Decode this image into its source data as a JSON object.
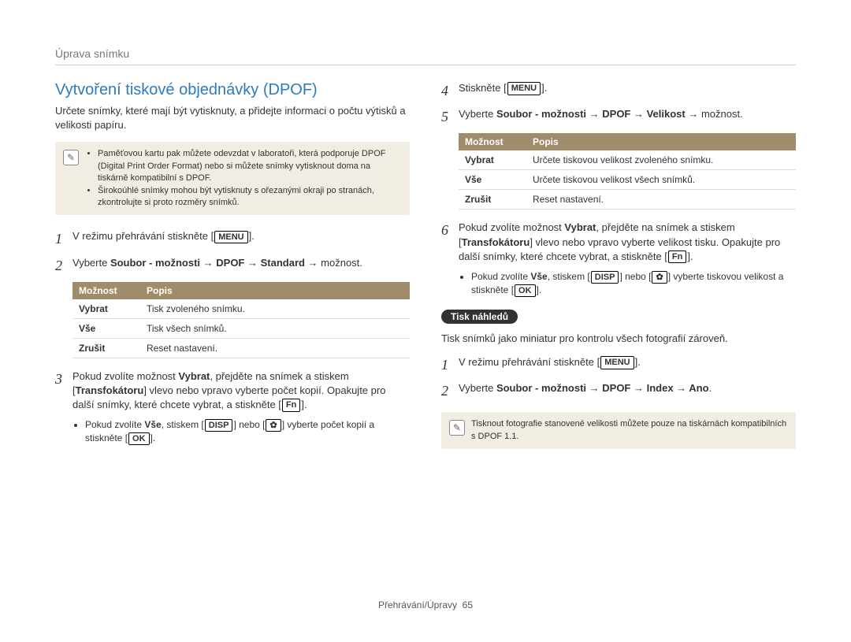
{
  "header": "Úprava snímku",
  "left": {
    "title": "Vytvoření tiskové objednávky (DPOF)",
    "intro": "Určete snímky, které mají být vytisknuty, a přidejte informaci o počtu výtisků a velikosti papíru.",
    "note_icon": "✎",
    "notes": [
      "Paměťovou kartu pak můžete odevzdat v laboratoři, která podporuje DPOF (Digital Print Order Format) nebo si můžete snímky vytisknout doma na tiskárně kompatibilní s DPOF.",
      "Širokoúhlé snímky mohou být vytisknuty s ořezanými okraji po stranách, zkontrolujte si proto rozměry snímků."
    ],
    "step1_num": "1",
    "step1_a": "V režimu přehrávání stiskněte [",
    "step1_btn": "MENU",
    "step1_b": "].",
    "step2_num": "2",
    "step2_a": "Vyberte ",
    "step2_bold": "Soubor - možnosti → DPOF → Standard",
    "step2_b": " → možnost.",
    "table_h1": "Možnost",
    "table_h2": "Popis",
    "table_rows": [
      {
        "k": "Vybrat",
        "v": "Tisk zvoleného snímku."
      },
      {
        "k": "Vše",
        "v": "Tisk všech snímků."
      },
      {
        "k": "Zrušit",
        "v": "Reset nastavení."
      }
    ],
    "step3_num": "3",
    "step3_a": "Pokud zvolíte možnost ",
    "step3_bold1": "Vybrat",
    "step3_b": ", přejděte na snímek a stiskem [",
    "step3_bold2": "Transfokátoru",
    "step3_c": "] vlevo nebo vpravo vyberte počet kopií. Opakujte pro další snímky, které chcete vybrat, a stiskněte [",
    "step3_btn": "Fn",
    "step3_d": "].",
    "bullet3_a": "Pokud zvolíte ",
    "bullet3_bold": "Vše",
    "bullet3_b": ", stiskem [",
    "bullet3_btn1": "DISP",
    "bullet3_c": "] nebo [",
    "bullet3_btn2": "✿",
    "bullet3_d": "] vyberte počet kopií a stiskněte [",
    "bullet3_btn3": "OK",
    "bullet3_e": "]."
  },
  "right": {
    "step4_num": "4",
    "step4_a": "Stiskněte [",
    "step4_btn": "MENU",
    "step4_b": "].",
    "step5_num": "5",
    "step5_a": "Vyberte ",
    "step5_bold": "Soubor - možnosti → DPOF → Velikost",
    "step5_b": " → možnost.",
    "table_h1": "Možnost",
    "table_h2": "Popis",
    "table_rows": [
      {
        "k": "Vybrat",
        "v": "Určete tiskovou velikost zvoleného snímku."
      },
      {
        "k": "Vše",
        "v": "Určete tiskovou velikost všech snímků."
      },
      {
        "k": "Zrušit",
        "v": "Reset nastavení."
      }
    ],
    "step6_num": "6",
    "step6_a": "Pokud zvolíte možnost ",
    "step6_bold1": "Vybrat",
    "step6_b": ", přejděte na snímek a stiskem [",
    "step6_bold2": "Transfokátoru",
    "step6_c": "] vlevo nebo vpravo vyberte velikost tisku. Opakujte pro další snímky, které chcete vybrat, a stiskněte [",
    "step6_btn": "Fn",
    "step6_d": "].",
    "bullet6_a": "Pokud zvolíte ",
    "bullet6_bold": "Vše",
    "bullet6_b": ", stiskem [",
    "bullet6_btn1": "DISP",
    "bullet6_c": "] nebo [",
    "bullet6_btn2": "✿",
    "bullet6_d": "] vyberte tiskovou velikost a stiskněte [",
    "bullet6_btn3": "OK",
    "bullet6_e": "].",
    "subhead": "Tisk náhledů",
    "subhead_text": "Tisk snímků jako miniatur pro kontrolu všech fotografií zároveň.",
    "idx1_num": "1",
    "idx1_a": "V režimu přehrávání stiskněte [",
    "idx1_btn": "MENU",
    "idx1_b": "].",
    "idx2_num": "2",
    "idx2_a": "Vyberte ",
    "idx2_bold": "Soubor - možnosti → DPOF → Index → Ano",
    "idx2_b": ".",
    "note_icon": "✎",
    "note": "Tisknout fotografie stanovené velikosti můžete pouze na tiskárnách kompatibilních s DPOF 1.1."
  },
  "footer_label": "Přehrávání/Úpravy",
  "footer_page": "65"
}
